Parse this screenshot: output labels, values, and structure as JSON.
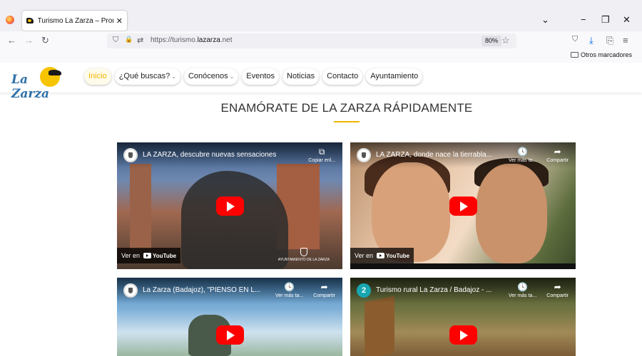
{
  "browser": {
    "tab_title": "Turismo La Zarza – Promoción",
    "tab_close": "✕",
    "url_prefix": "https://turismo.",
    "url_domain": "lazarza",
    "url_suffix": ".net",
    "zoom": "80%",
    "bookmark_folder": "Otros marcadores",
    "icons": {
      "back": "←",
      "forward": "→",
      "reload": "↻",
      "shield": "⛉",
      "lock": "🔒",
      "permissions": "⇄",
      "star": "☆",
      "pocket": "⛉",
      "download": "⤓",
      "extensions": "⎘",
      "menu": "≡",
      "tab_list": "⌄",
      "minimize": "−",
      "restore": "❐",
      "close": "✕"
    }
  },
  "site": {
    "logo_text": "La Zarza",
    "menu": [
      {
        "label": "Inicio",
        "active": true,
        "dropdown": false
      },
      {
        "label": "¿Qué buscas?",
        "active": false,
        "dropdown": true
      },
      {
        "label": "Conócenos",
        "active": false,
        "dropdown": true
      },
      {
        "label": "Eventos",
        "active": false,
        "dropdown": false
      },
      {
        "label": "Noticias",
        "active": false,
        "dropdown": false
      },
      {
        "label": "Contacto",
        "active": false,
        "dropdown": false
      },
      {
        "label": "Ayuntamiento",
        "active": false,
        "dropdown": false
      }
    ],
    "caret": "⌄",
    "heading": "ENAMÓRATE DE LA ZARZA RÁPIDAMENTE",
    "accent_color": "#f0b400"
  },
  "videos": [
    {
      "title": "LA ZARZA, descubre nuevas sensaciones",
      "actions": [
        {
          "icon": "copy-icon",
          "glyph": "⧉",
          "label": "Copiar enl..."
        }
      ],
      "watch_label": "Ver en",
      "yt_label": "YouTube",
      "stamp": "AYUNTAMIENTO DE LA ZARZA"
    },
    {
      "title": "LA ZARZA, donde nace la tierrabla...",
      "actions": [
        {
          "icon": "clock-icon",
          "glyph": "🕓",
          "label": "Ver más ta..."
        },
        {
          "icon": "share-icon",
          "glyph": "➦",
          "label": "Compartir"
        }
      ],
      "watch_label": "Ver en",
      "yt_label": "YouTube"
    },
    {
      "title": "La Zarza (Badajoz), \"PIENSO EN L...",
      "actions": [
        {
          "icon": "clock-icon",
          "glyph": "🕓",
          "label": "Ver más ta..."
        },
        {
          "icon": "share-icon",
          "glyph": "➦",
          "label": "Compartir"
        }
      ]
    },
    {
      "channel_number": "2",
      "title": "Turismo rural La Zarza / Badajoz - ...",
      "actions": [
        {
          "icon": "clock-icon",
          "glyph": "🕓",
          "label": "Ver más ta..."
        },
        {
          "icon": "share-icon",
          "glyph": "➦",
          "label": "Compartir"
        }
      ]
    }
  ]
}
